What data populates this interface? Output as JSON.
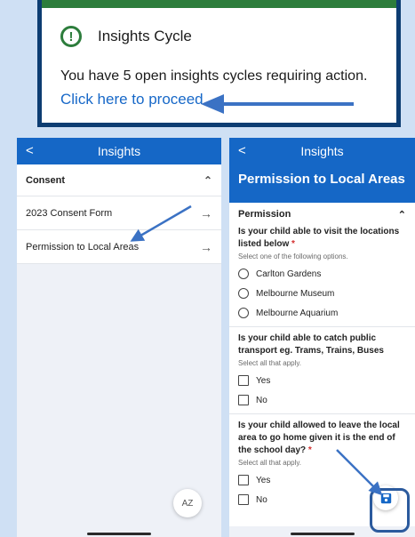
{
  "notice": {
    "icon": "alert-circle-icon",
    "title": "Insights Cycle",
    "message": "You have 5 open insights cycles requiring action.",
    "link": "Click here to proceed"
  },
  "left_screen": {
    "appbar_title": "Insights",
    "back_glyph": "<",
    "section_title": "Consent",
    "items": [
      {
        "label": "2023 Consent Form"
      },
      {
        "label": "Permission to Local Areas"
      }
    ],
    "sort_button": "AZ"
  },
  "right_screen": {
    "appbar_title": "Insights",
    "back_glyph": "<",
    "page_title": "Permission to Local Areas",
    "section_title": "Permission",
    "q1": {
      "text": "Is your child able to visit the locations listed below",
      "required_mark": "*",
      "hint": "Select one of the following options.",
      "options": [
        "Carlton Gardens",
        "Melbourne Museum",
        "Melbourne Aquarium"
      ]
    },
    "q2": {
      "text": "Is your child able to catch public transport eg. Trams, Trains, Buses",
      "hint": "Select all that apply.",
      "options": [
        "Yes",
        "No"
      ]
    },
    "q3": {
      "text": "Is your child allowed to leave the local area to go home given it is the end of the school day?",
      "required_mark": "*",
      "hint": "Select all that apply.",
      "options": [
        "Yes",
        "No"
      ]
    }
  },
  "colors": {
    "appbar": "#1567c6",
    "notice_border": "#0d3d72",
    "notice_accent": "#2d7d3c",
    "link": "#1768c8",
    "annotation_arrow": "#3b72c4"
  }
}
